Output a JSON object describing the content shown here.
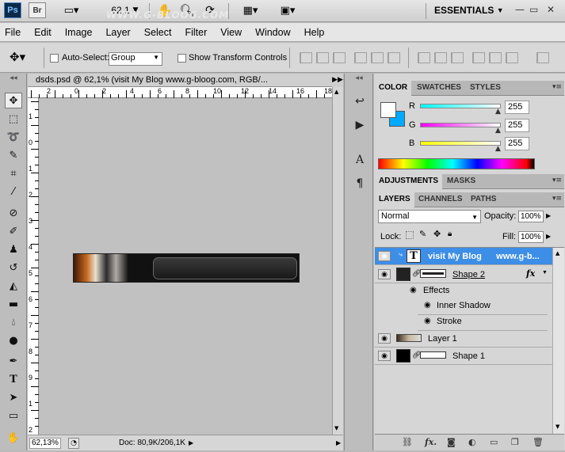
{
  "app": {
    "logo": "Ps",
    "bridge": "Br",
    "zoom_display": "62,1",
    "workspace": "ESSENTIALS"
  },
  "menu": [
    "File",
    "Edit",
    "Image",
    "Layer",
    "Select",
    "Filter",
    "View",
    "Window",
    "Help"
  ],
  "options": {
    "auto_select_label": "Auto-Select:",
    "auto_select_value": "Group",
    "show_transform_label": "Show Transform Controls"
  },
  "document": {
    "tab_title": "dsds.psd @ 62,1% (visit My Blog      www.g-bloog.com, RGB/...",
    "banner_text": "WWW.G-BLOOG.COM",
    "zoom_field": "62,13%",
    "doc_size": "Doc: 80,9K/206,1K",
    "ruler_h": [
      "2",
      "0",
      "2",
      "4",
      "6",
      "8",
      "10",
      "12",
      "14",
      "16",
      "18"
    ],
    "ruler_v": [
      "1",
      "0",
      "1",
      "2",
      "3",
      "4",
      "5",
      "6",
      "7",
      "8",
      "9",
      "1",
      "2"
    ]
  },
  "color_panel": {
    "tabs": [
      "COLOR",
      "SWATCHES",
      "STYLES"
    ],
    "r_label": "R",
    "g_label": "G",
    "b_label": "B",
    "r": "255",
    "g": "255",
    "b": "255",
    "fg_color": "#ffffff",
    "bg_color": "#00aaff"
  },
  "adjust_panel": {
    "tabs": [
      "ADJUSTMENTS",
      "MASKS"
    ]
  },
  "layers_panel": {
    "tabs": [
      "LAYERS",
      "CHANNELS",
      "PATHS"
    ],
    "blend_mode": "Normal",
    "opacity_label": "Opacity:",
    "opacity": "100%",
    "lock_label": "Lock:",
    "fill_label": "Fill:",
    "fill": "100%",
    "layers": [
      {
        "name": "visit My Blog      www.g-b...",
        "type": "text",
        "selected": true
      },
      {
        "name": "Shape 2",
        "type": "shape",
        "fx": "fx"
      },
      {
        "name": "Effects",
        "type": "effects"
      },
      {
        "name": "Inner Shadow",
        "type": "effect"
      },
      {
        "name": "Stroke",
        "type": "effect"
      },
      {
        "name": "Layer 1",
        "type": "pixel"
      },
      {
        "name": "Shape 1",
        "type": "shape"
      }
    ]
  }
}
